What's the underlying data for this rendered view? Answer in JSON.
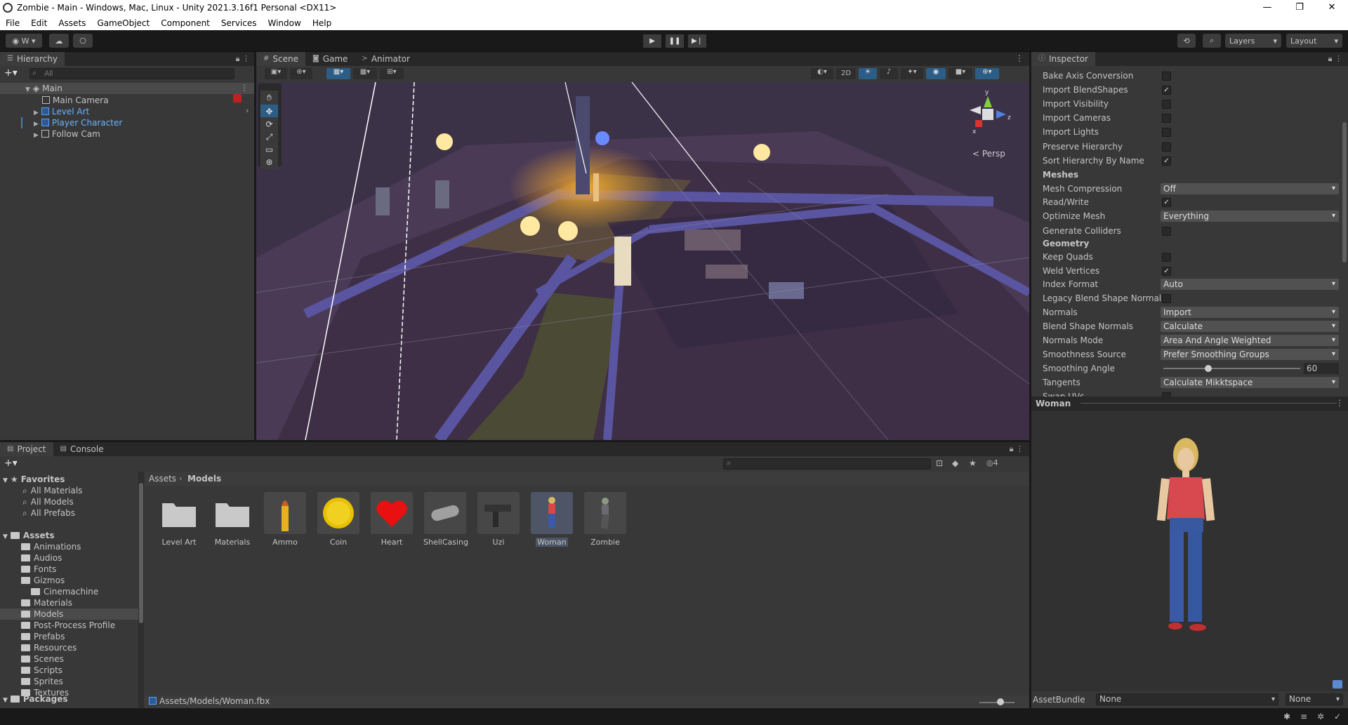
{
  "window": {
    "title": "Zombie - Main - Windows, Mac, Linux - Unity 2021.3.16f1 Personal <DX11>",
    "minimize": "—",
    "maximize": "❐",
    "close": "✕"
  },
  "menu": [
    "File",
    "Edit",
    "Assets",
    "GameObject",
    "Component",
    "Services",
    "Window",
    "Help"
  ],
  "toolbar": {
    "account": "W",
    "layers": "Layers",
    "layout": "Layout"
  },
  "hierarchy": {
    "tab": "Hierarchy",
    "search_placeholder": "All",
    "scene": "Main",
    "items": [
      "Main Camera",
      "Level Art",
      "Player Character",
      "Follow Cam"
    ]
  },
  "scene_tabs": [
    "Scene",
    "Game",
    "Animator"
  ],
  "scene_view": {
    "mode_2d": "2D",
    "persp": "< Persp",
    "gizmo_y": "y",
    "gizmo_x": "x",
    "gizmo_z": "z"
  },
  "inspector": {
    "tab": "Inspector",
    "rows": [
      {
        "label": "Bake Axis Conversion",
        "type": "check",
        "checked": false
      },
      {
        "label": "Import BlendShapes",
        "type": "check",
        "checked": true
      },
      {
        "label": "Import Visibility",
        "type": "check",
        "checked": false
      },
      {
        "label": "Import Cameras",
        "type": "check",
        "checked": false
      },
      {
        "label": "Import Lights",
        "type": "check",
        "checked": false
      },
      {
        "label": "Preserve Hierarchy",
        "type": "check",
        "checked": false
      },
      {
        "label": "Sort Hierarchy By Name",
        "type": "check",
        "checked": true
      },
      {
        "label": "Meshes",
        "type": "header"
      },
      {
        "label": "Mesh Compression",
        "type": "dropdown",
        "value": "Off"
      },
      {
        "label": "Read/Write",
        "type": "check",
        "checked": true
      },
      {
        "label": "Optimize Mesh",
        "type": "dropdown",
        "value": "Everything"
      },
      {
        "label": "Generate Colliders",
        "type": "check",
        "checked": false
      },
      {
        "label": "Geometry",
        "type": "header"
      },
      {
        "label": "Keep Quads",
        "type": "check",
        "checked": false
      },
      {
        "label": "Weld Vertices",
        "type": "check",
        "checked": true
      },
      {
        "label": "Index Format",
        "type": "dropdown",
        "value": "Auto"
      },
      {
        "label": "Legacy Blend Shape Normals",
        "type": "check",
        "checked": false
      },
      {
        "label": "Normals",
        "type": "dropdown",
        "value": "Import"
      },
      {
        "label": "Blend Shape Normals",
        "type": "dropdown",
        "value": "Calculate"
      },
      {
        "label": "Normals Mode",
        "type": "dropdown",
        "value": "Area And Angle Weighted"
      },
      {
        "label": "Smoothness Source",
        "type": "dropdown",
        "value": "Prefer Smoothing Groups"
      },
      {
        "label": "Smoothing Angle",
        "type": "slider",
        "value": "60",
        "fraction": 0.33
      },
      {
        "label": "Tangents",
        "type": "dropdown",
        "value": "Calculate Mikktspace"
      },
      {
        "label": "Swap UVs",
        "type": "check",
        "checked": false
      }
    ],
    "preview_title": "Woman",
    "assetbundle_label": "AssetBundle",
    "assetbundle_value": "None",
    "assetbundle_variant": "None"
  },
  "project": {
    "tabs": [
      "Project",
      "Console"
    ],
    "favorites_label": "Favorites",
    "favorites": [
      "All Materials",
      "All Models",
      "All Prefabs"
    ],
    "assets_label": "Assets",
    "folders": [
      "Animations",
      "Audios",
      "Fonts",
      "Gizmos",
      "Cinemachine",
      "Materials",
      "Models",
      "Post-Process Profile",
      "Prefabs",
      "Resources",
      "Scenes",
      "Scripts",
      "Sprites",
      "Textures"
    ],
    "packages_label": "Packages",
    "breadcrumb": [
      "Assets",
      "Models"
    ],
    "items": [
      "Level Art",
      "Materials",
      "Ammo",
      "Coin",
      "Heart",
      "ShellCasing",
      "Uzi",
      "Woman",
      "Zombie"
    ],
    "selected": "Woman",
    "path": "Assets/Models/Woman.fbx",
    "hidden_count": "4"
  },
  "colors": {
    "accent": "#2c5d87",
    "panel": "#383838",
    "selected_blue": "#6ab4ff"
  }
}
